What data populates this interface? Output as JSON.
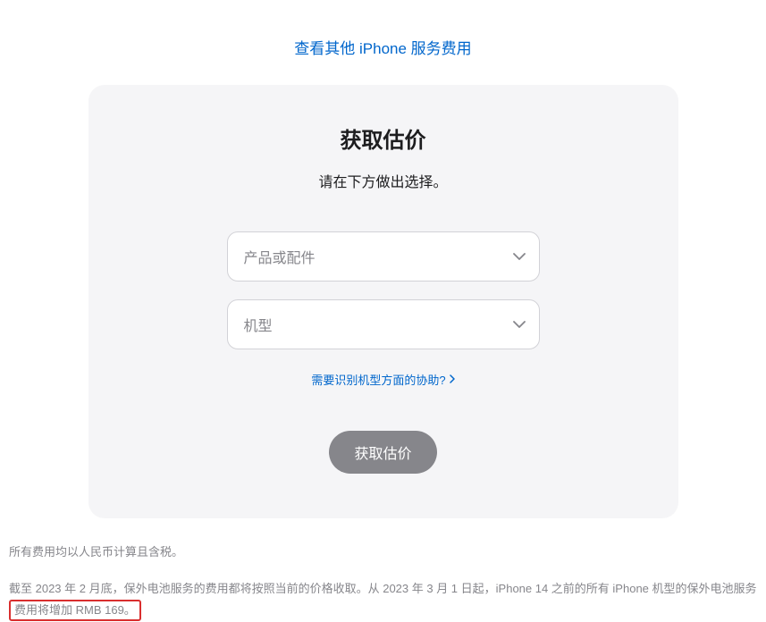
{
  "topLink": {
    "label": "查看其他 iPhone 服务费用"
  },
  "card": {
    "title": "获取估价",
    "subtitle": "请在下方做出选择。",
    "select1": {
      "placeholder": "产品或配件"
    },
    "select2": {
      "placeholder": "机型"
    },
    "helpLink": {
      "label": "需要识别机型方面的协助?"
    },
    "button": {
      "label": "获取估价"
    }
  },
  "footnotes": {
    "line1": "所有费用均以人民币计算且含税。",
    "line2_prefix": "截至 2023 年 2 月底，保外电池服务的费用都将按照当前的价格收取。从 2023 年 3 月 1 日起，iPhone 14 之前的所有 iPhone 机型的保外电池服务",
    "line2_highlight": "费用将增加 RMB 169。"
  }
}
